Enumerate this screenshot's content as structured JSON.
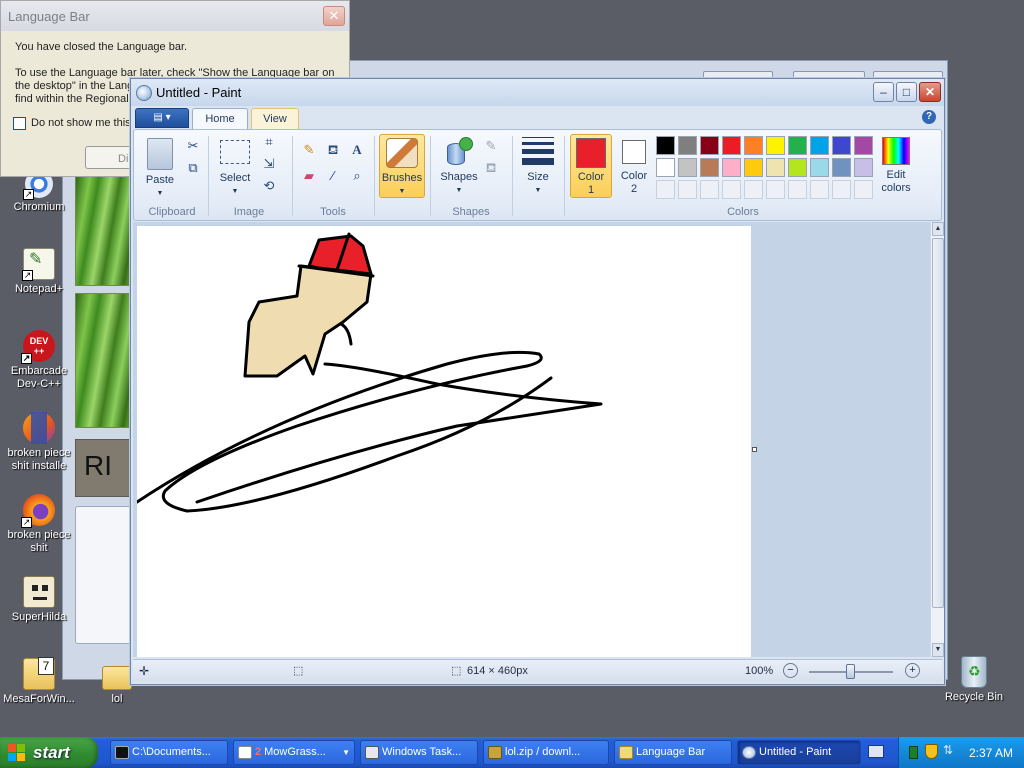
{
  "language_bar": {
    "title": "Language Bar",
    "close_glyph": "✕",
    "line1": "You have closed the Language bar.",
    "line2": "To use the Language bar later, check \"Show the Language bar on",
    "line3": "the desktop\" in the Lang",
    "line4": "find within the Regional a",
    "checkbox_label": "Do not show me this",
    "partial_button": "Di"
  },
  "background_window": {
    "partial_text": "RI"
  },
  "desktop_icons": [
    {
      "label": "Chromium",
      "icon": "chromium-icon"
    },
    {
      "label": "Notepad+",
      "icon": "notepad-plus-plus-icon"
    },
    {
      "label_1": "Embarcade",
      "label_2": "Dev-C++",
      "badge": "DEV\n++",
      "icon": "devcpp-icon"
    },
    {
      "label_1": "broken piece",
      "label_2": "shit installe",
      "icon": "firefox-installer-icon"
    },
    {
      "label_1": "broken piece",
      "label_2": "shit",
      "icon": "firefox-icon"
    },
    {
      "label": "SuperHilda",
      "icon": "superhilda-icon"
    },
    {
      "label": "MesaForWin...",
      "icon": "mesa-icon"
    },
    {
      "label": "lol",
      "icon": "folder-icon"
    },
    {
      "label": "Recycle Bin",
      "icon": "recycle-bin-icon"
    }
  ],
  "paint": {
    "title": "Untitled - Paint",
    "tabs": {
      "home": "Home",
      "view": "View"
    },
    "help_glyph": "?",
    "groups": {
      "clipboard": "Clipboard",
      "image": "Image",
      "tools": "Tools",
      "shapes": "Shapes",
      "colors": "Colors"
    },
    "buttons": {
      "paste": "Paste",
      "select": "Select",
      "brushes": "Brushes",
      "shapes": "Shapes",
      "size": "Size",
      "color1_a": "Color",
      "color1_b": "1",
      "color2_a": "Color",
      "color2_b": "2",
      "edit_colors_a": "Edit",
      "edit_colors_b": "colors"
    },
    "color1": "#e8202a",
    "color2": "#ffffff",
    "palette_row1": [
      "#000000",
      "#7f7f7f",
      "#880015",
      "#ed1c24",
      "#ff7f27",
      "#fff200",
      "#22b14c",
      "#00a2e8",
      "#3f48cc",
      "#a349a4"
    ],
    "palette_row2": [
      "#ffffff",
      "#c3c3c3",
      "#b97a57",
      "#ffaec9",
      "#ffc90e",
      "#efe4b0",
      "#b5e61d",
      "#99d9ea",
      "#7092be",
      "#c8bfe7"
    ],
    "status": {
      "dimensions": "614 × 460px",
      "zoom": "100%"
    },
    "zoom_fraction": 0.5
  },
  "taskbar": {
    "start": "start",
    "tasks": [
      {
        "label": "C:\\Documents...",
        "icon": "cmd-icon"
      },
      {
        "label": "MowGrass...",
        "badge": "2",
        "icon": "group-icon"
      },
      {
        "label": "Windows Task...",
        "icon": "task-manager-icon"
      },
      {
        "label": "lol.zip / downl...",
        "icon": "archive-icon"
      },
      {
        "label": "Language Bar",
        "icon": "folder-icon"
      },
      {
        "label": "Untitled - Paint",
        "icon": "paint-icon"
      }
    ],
    "clock": "2:37 AM"
  },
  "colors": {
    "skin": "#efdcb0",
    "hat": "#e8202a",
    "stroke": "#000000"
  }
}
